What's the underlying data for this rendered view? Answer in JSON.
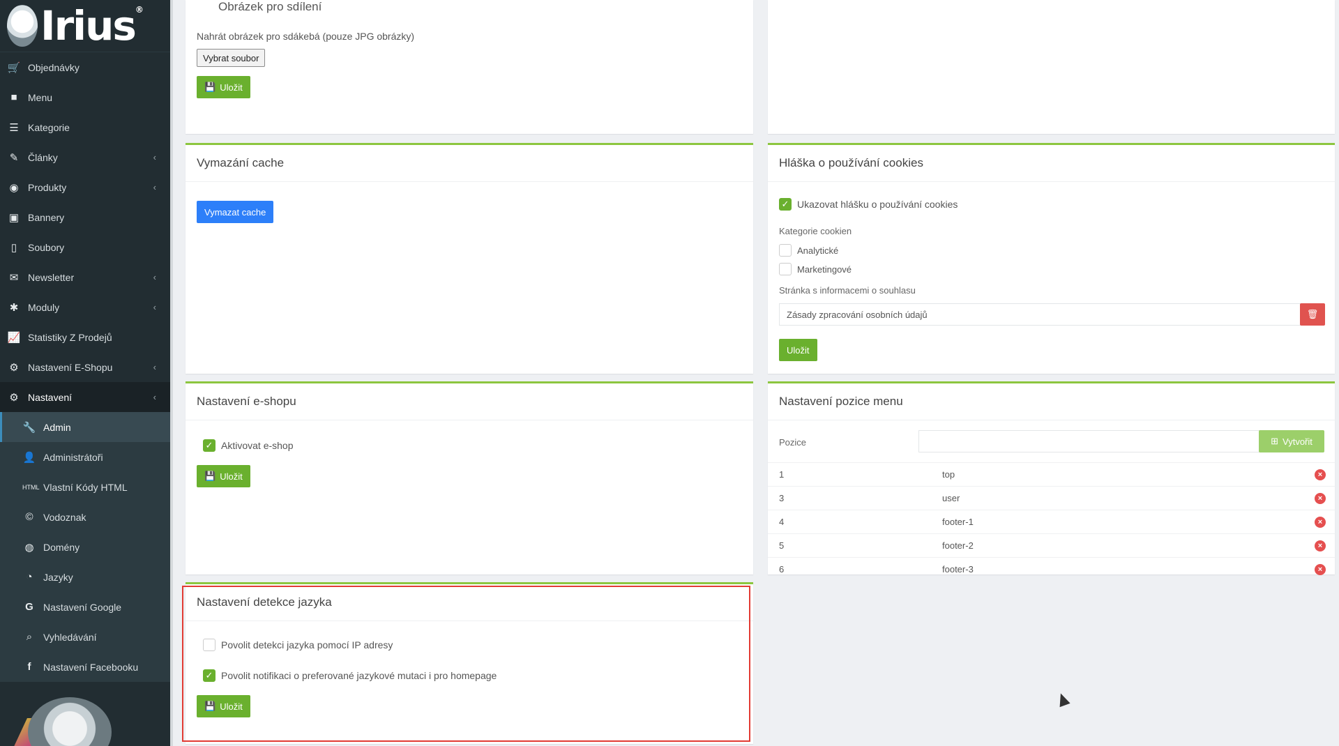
{
  "logo": {
    "text": "Irius",
    "reg": "®"
  },
  "sidebar": {
    "items": [
      {
        "label": "Objednávky",
        "icon": "cart-icon"
      },
      {
        "label": "Menu",
        "icon": "folder-icon"
      },
      {
        "label": "Kategorie",
        "icon": "list-icon"
      },
      {
        "label": "Články",
        "icon": "pencil-icon",
        "chevron": true
      },
      {
        "label": "Produkty",
        "icon": "palette-icon",
        "chevron": true
      },
      {
        "label": "Bannery",
        "icon": "image-icon"
      },
      {
        "label": "Soubory",
        "icon": "file-icon"
      },
      {
        "label": "Newsletter",
        "icon": "envelope-icon",
        "chevron": true
      },
      {
        "label": "Moduly",
        "icon": "puzzle-icon",
        "chevron": true
      },
      {
        "label": "Statistiky Z Prodejů",
        "icon": "line-chart-icon"
      },
      {
        "label": "Nastavení E-Shopu",
        "icon": "cogs-icon",
        "chevron": true
      },
      {
        "label": "Nastavení",
        "icon": "cogs-icon",
        "chevron": true
      }
    ],
    "subitems": [
      {
        "label": "Admin",
        "icon": "wrench-icon"
      },
      {
        "label": "Administrátoři",
        "icon": "user-icon"
      },
      {
        "label": "Vlastní Kódy HTML",
        "icon": "html-icon"
      },
      {
        "label": "Vodoznak",
        "icon": "copyright-icon"
      },
      {
        "label": "Domény",
        "icon": "globe-icon"
      },
      {
        "label": "Jazyky",
        "icon": "language-icon"
      },
      {
        "label": "Nastavení Google",
        "icon": "google-icon"
      },
      {
        "label": "Vyhledávání",
        "icon": "search-icon"
      },
      {
        "label": "Nastavení Facebooku",
        "icon": "facebook-icon"
      }
    ]
  },
  "share_image": {
    "title": "Obrázek pro sdílení",
    "upload_label": "Nahrát obrázek pro sdákebá (pouze JPG obrázky)",
    "file_button": "Vybrat soubor",
    "save": "Uložit"
  },
  "cache": {
    "title": "Vymazání cache",
    "button": "Vymazat cache"
  },
  "cookies": {
    "title": "Hláška o používání cookies",
    "show_label": "Ukazovat hlášku o používání cookies",
    "categories_label": "Kategorie cookien",
    "analytic": "Analytické",
    "marketing": "Marketingové",
    "page_label": "Stránka s informacemi o souhlasu",
    "page_value": "Zásady zpracování osobních údajů",
    "save": "Uložit"
  },
  "eshop": {
    "title": "Nastavení e-shopu",
    "activate": "Aktivovat e-shop",
    "save": "Uložit"
  },
  "menu_pos": {
    "title": "Nastavení pozice menu",
    "position_label": "Pozice",
    "create": "Vytvořit",
    "rows": [
      {
        "id": "1",
        "name": "top"
      },
      {
        "id": "3",
        "name": "user"
      },
      {
        "id": "4",
        "name": "footer-1"
      },
      {
        "id": "5",
        "name": "footer-2"
      },
      {
        "id": "6",
        "name": "footer-3"
      }
    ]
  },
  "lang_detect": {
    "title": "Nastavení detekce jazyka",
    "ip_label": "Povolit detekci jazyka pomocí IP adresy",
    "notify_label": "Povolit notifikaci o preferované jazykové mutaci i pro homepage",
    "save": "Uložit"
  },
  "colors": {
    "accent": "#8cc63f",
    "button_green": "#6ab02e",
    "button_blue": "#2d7ff9",
    "danger": "#e0534f",
    "highlight": "#e23b33"
  }
}
